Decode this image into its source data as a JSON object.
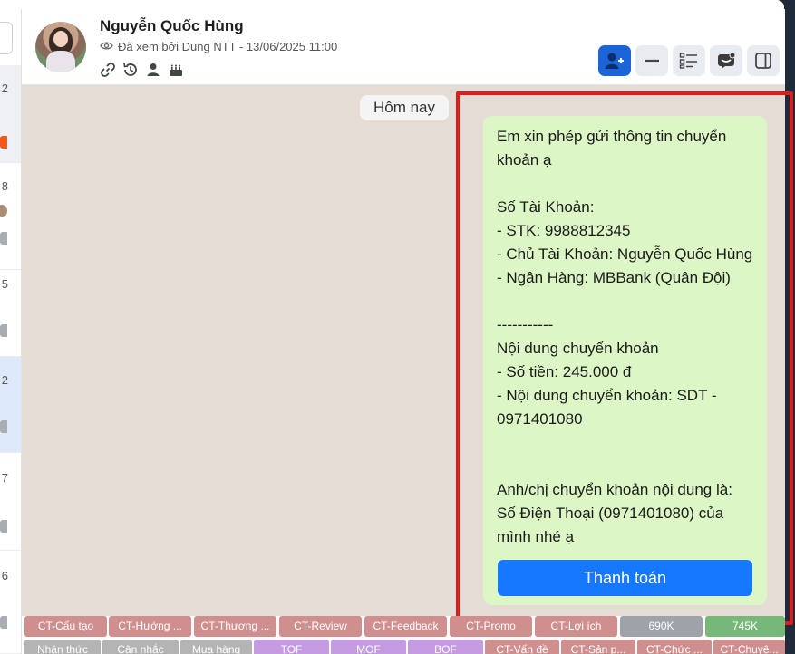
{
  "contact": {
    "name": "Nguyễn Quốc Hùng",
    "seen": "Đã xem bởi Dung NTT - 13/06/2025 11:00"
  },
  "left_list": {
    "counts": [
      "2",
      "8",
      "5",
      "2",
      "7",
      "6"
    ]
  },
  "header_icons": [
    "link-icon",
    "history-icon",
    "person-icon",
    "birthday-cake-icon"
  ],
  "header_buttons": [
    "add-member-button",
    "minimize-button",
    "list-button",
    "chat-icon-button",
    "panel-toggle-button"
  ],
  "chat": {
    "date_label": "Hôm nay",
    "message": "Em xin phép gửi thông tin chuyển khoản ạ\n\nSố Tài Khoản:\n- STK: 9988812345\n- Chủ Tài Khoản: Nguyễn Quốc Hùng\n- Ngân Hàng: MBBank (Quân Đội)\n\n-----------\nNội dung chuyển khoản\n- Số tiền: 245.000 đ\n- Nội dung chuyển khoản: SDT - 0971401080\n\n\nAnh/chị chuyển khoản nội dung là:\nSố Điện Thoại (0971401080)  của mình nhé ạ",
    "pay_button": "Thanh toán"
  },
  "tags_row1": [
    "CT-Cấu tạo",
    "CT-Hướng ...",
    "CT-Thương ...",
    "CT-Review",
    "CT-Feedback",
    "CT-Promo",
    "CT-Lợi ích",
    "690K",
    "745K"
  ],
  "tags_row2": [
    "Nhận thức",
    "Cân nhắc",
    "Mua hàng",
    "TOF",
    "MOF",
    "BOF",
    "CT-Vấn đề",
    "CT-Sản p...",
    "CT-Chức ...",
    "CT-Chuyê..."
  ],
  "colors": {
    "accent": "#1d64d8",
    "pay_button": "#1677ff",
    "bubble": "#dcf7c5",
    "chat_bg": "#e5dcd6",
    "highlight_box": "#e01b1b"
  }
}
